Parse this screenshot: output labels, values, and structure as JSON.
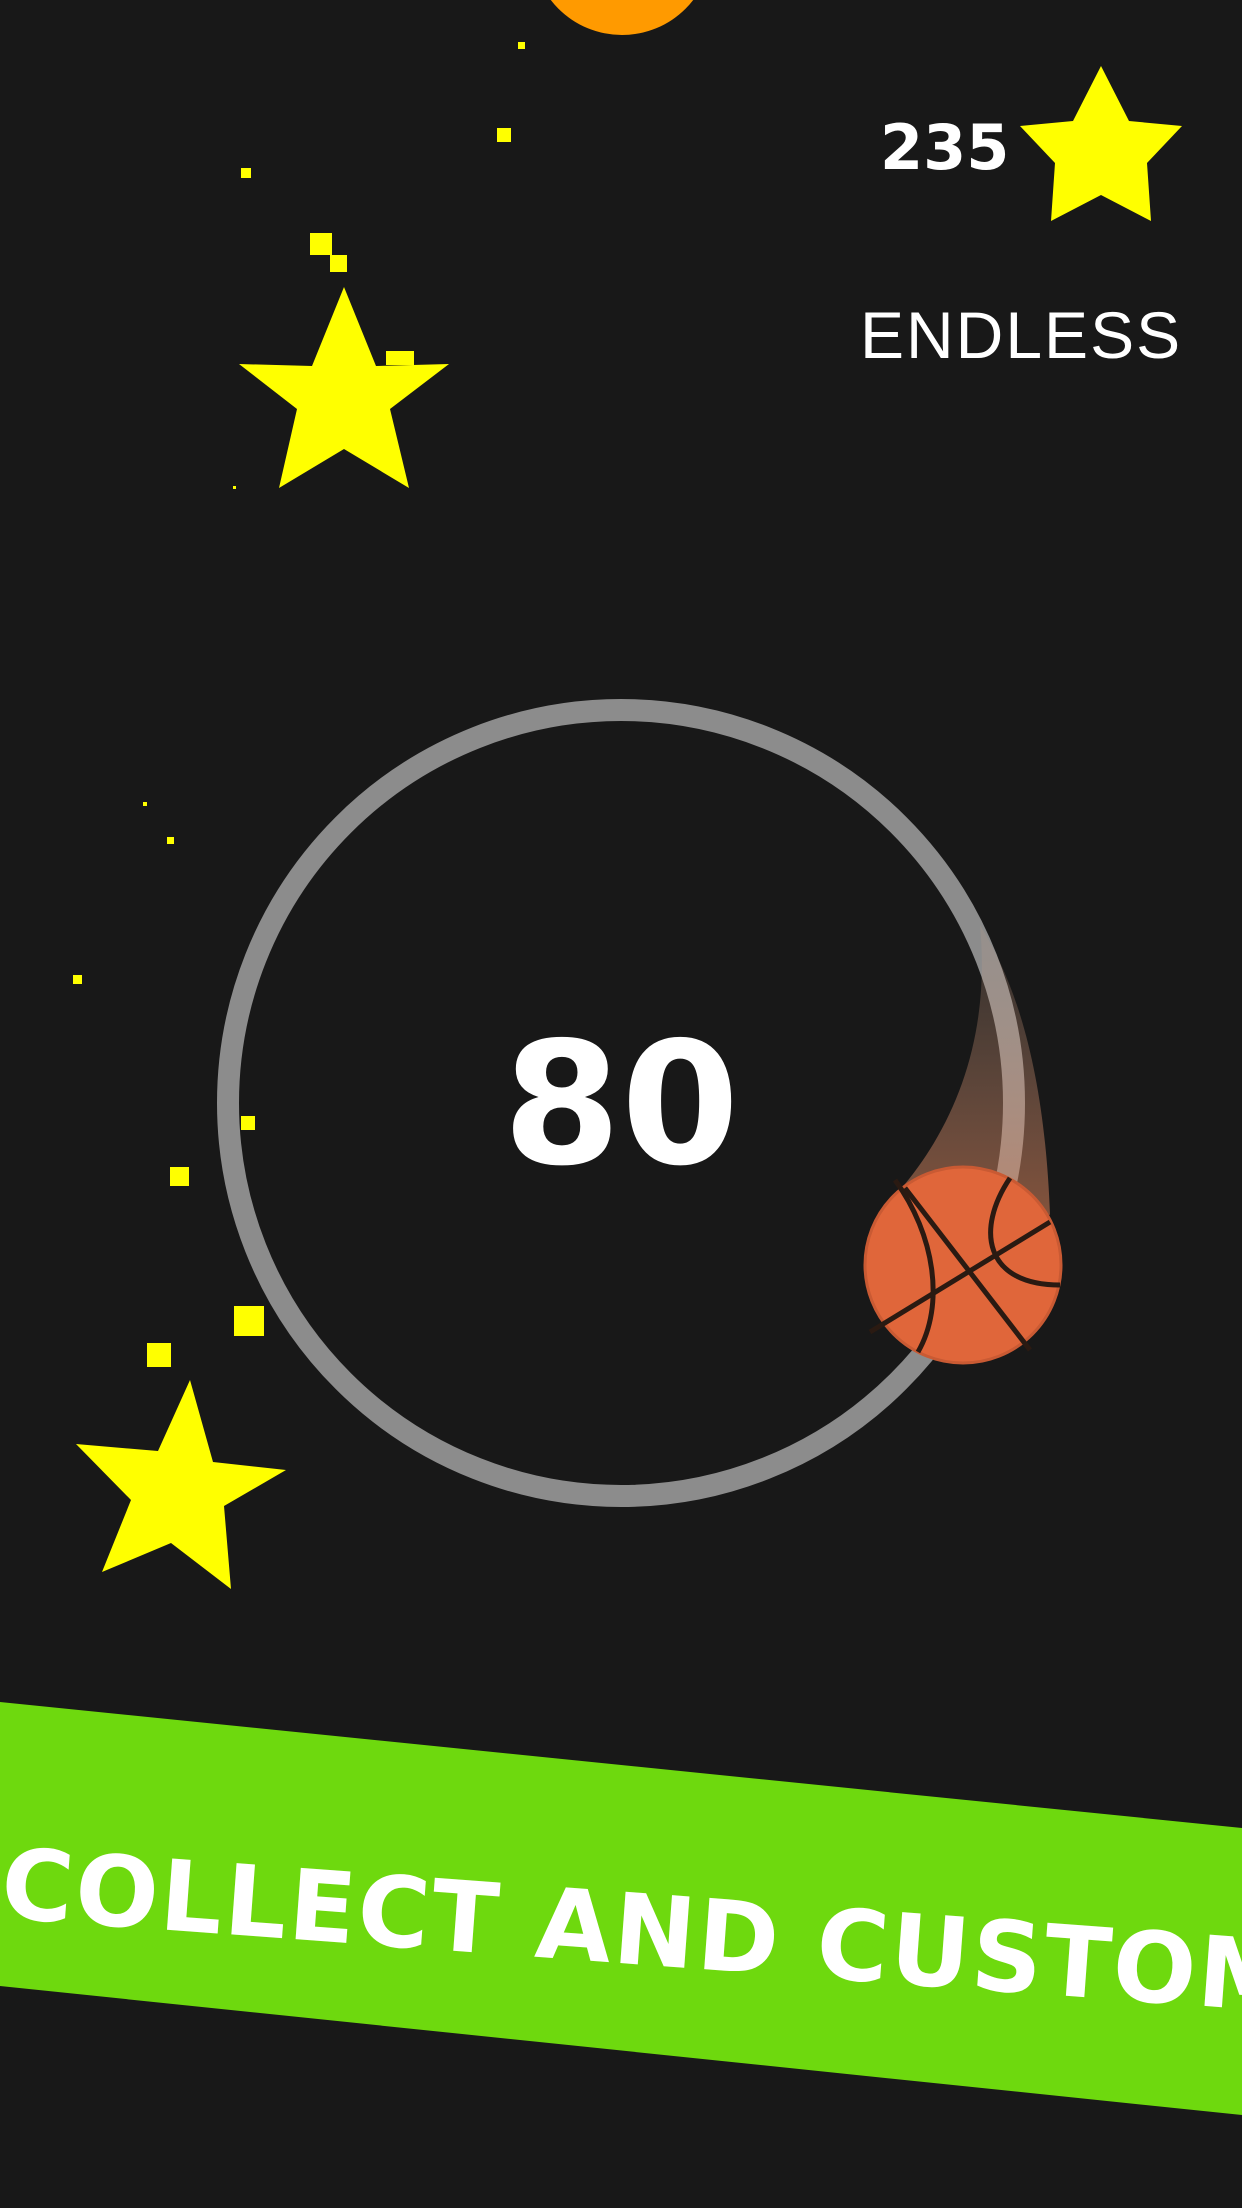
{
  "hud": {
    "star_count": "235",
    "mode_label": "ENDLESS"
  },
  "game": {
    "score": "80"
  },
  "banner": {
    "text": "COLLECT AND CUSTOMIZE"
  },
  "colors": {
    "background": "#181818",
    "star": "#ffff00",
    "ring": "#8c8c8c",
    "ball": "#e0663a",
    "ball_lines": "#2a1a12",
    "banner": "#6ed90e",
    "orange_orb": "#ff9a00"
  },
  "icons": [
    "star-icon",
    "basketball-icon"
  ]
}
